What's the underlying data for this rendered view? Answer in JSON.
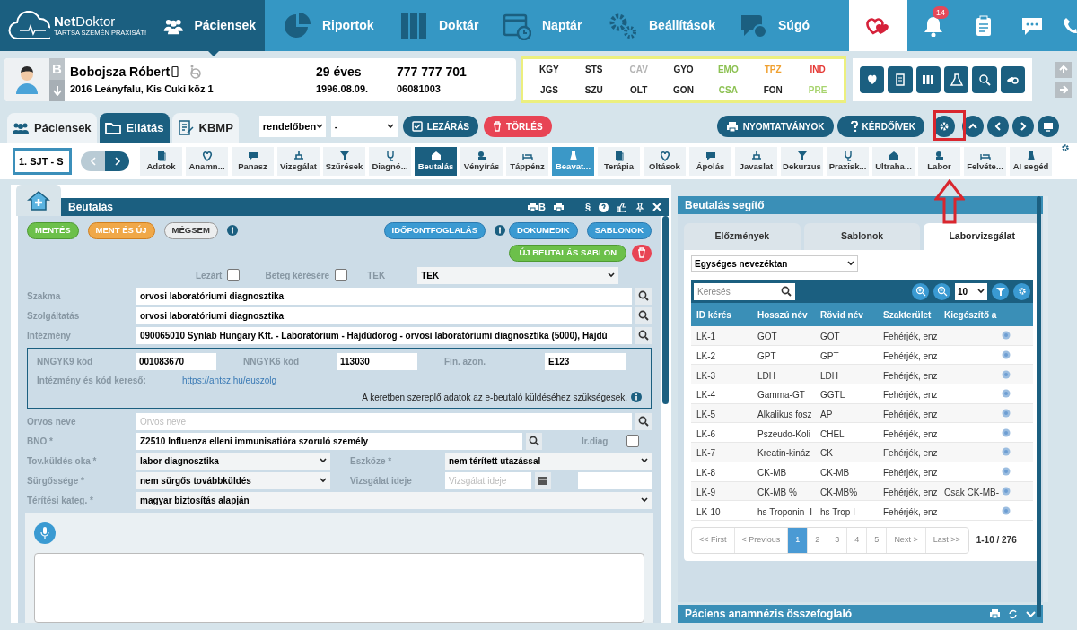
{
  "nav": {
    "logo": {
      "name": "**Net**Doktor",
      "tagline": "TARTSA SZEMÉN PRAXISÁT!"
    },
    "items": [
      {
        "label": "Páciensek",
        "selected": true
      },
      {
        "label": "Riportok",
        "selected": false
      },
      {
        "label": "Doktár",
        "selected": false
      },
      {
        "label": "Naptár",
        "selected": false
      },
      {
        "label": "Beállítások",
        "selected": false
      },
      {
        "label": "Súgó",
        "selected": false
      }
    ],
    "notifications": "14"
  },
  "patient": {
    "initial": "B",
    "name": "Bobojsza Róbert",
    "address": "2016 Leányfalu, Kis Cuki köz 1",
    "age": "29 éves",
    "birth_date": "1996.08.09.",
    "phone": "777 777 701",
    "id_number": "06081003"
  },
  "flags": [
    {
      "code": "KGY",
      "color": "#222222"
    },
    {
      "code": "STS",
      "color": "#222222"
    },
    {
      "code": "CAV",
      "color": "#b4b4b4"
    },
    {
      "code": "GYO",
      "color": "#222222"
    },
    {
      "code": "EMO",
      "color": "#8cc152"
    },
    {
      "code": "TPZ",
      "color": "#f0a030"
    },
    {
      "code": "IND",
      "color": "#e53935"
    },
    {
      "code": "JGS",
      "color": "#222222"
    },
    {
      "code": "SZU",
      "color": "#222222"
    },
    {
      "code": "OLT",
      "color": "#222222"
    },
    {
      "code": "GON",
      "color": "#222222"
    },
    {
      "code": "CSA",
      "color": "#8cc152"
    },
    {
      "code": "FON",
      "color": "#222222"
    },
    {
      "code": "PRE",
      "color": "#a8d46f"
    }
  ],
  "main_tabs": [
    {
      "label": "Páciensek",
      "selected": false
    },
    {
      "label": "Ellátás",
      "selected": true
    },
    {
      "label": "KBMP",
      "selected": false
    }
  ],
  "status_selects": [
    "rendelőben",
    "-"
  ],
  "actions": [
    {
      "label": "LEZÁRÁS",
      "kind": "dark"
    },
    {
      "label": "TÖRLÉS",
      "kind": "danger"
    }
  ],
  "tools": [
    "NYOMTATVÁNYOK",
    "KÉRDŐÍVEK"
  ],
  "episode": "1. SJT - S",
  "modules": [
    {
      "label": "Adatok",
      "selected": false,
      "open": false
    },
    {
      "label": "Anamn...",
      "selected": false,
      "open": false
    },
    {
      "label": "Panasz",
      "selected": false,
      "open": false
    },
    {
      "label": "Vizsgálat",
      "selected": false,
      "open": false
    },
    {
      "label": "Szűrések",
      "selected": false,
      "open": false
    },
    {
      "label": "Diagnó...",
      "selected": false,
      "open": false
    },
    {
      "label": "Beutalás",
      "selected": true,
      "open": false
    },
    {
      "label": "Vényírás",
      "selected": false,
      "open": false
    },
    {
      "label": "Táppénz",
      "selected": false,
      "open": false
    },
    {
      "label": "Beavat...",
      "selected": false,
      "open": true
    },
    {
      "label": "Terápia",
      "selected": false,
      "open": false
    },
    {
      "label": "Oltások",
      "selected": false,
      "open": false
    },
    {
      "label": "Ápolás",
      "selected": false,
      "open": false
    },
    {
      "label": "Javaslat",
      "selected": false,
      "open": false
    },
    {
      "label": "Dekurzus",
      "selected": false,
      "open": false
    },
    {
      "label": "Praxisk...",
      "selected": false,
      "open": false
    },
    {
      "label": "Ultraha...",
      "selected": false,
      "open": false
    },
    {
      "label": "Labor",
      "selected": false,
      "open": false
    },
    {
      "label": "Felvéte...",
      "selected": false,
      "open": false
    },
    {
      "label": "AI segéd",
      "selected": false,
      "open": false
    }
  ],
  "referral": {
    "title": "Beutalás",
    "header_icon_text": [
      "B",
      "§"
    ],
    "buttons": [
      {
        "label": "MENTÉS",
        "kind": "green"
      },
      {
        "label": "MENT ÉS ÚJ",
        "kind": "orange"
      },
      {
        "label": "MÉGSEM",
        "kind": "plain"
      }
    ],
    "right_buttons": [
      "IDŐPONTFOGLALÁS",
      "DOKUMEDIK",
      "SABLONOK"
    ],
    "template_button": "ÚJ BEUTALÁS SABLON",
    "checks": [
      {
        "label": "Lezárt",
        "checked": false
      },
      {
        "label": "Beteg kérésére",
        "checked": false
      }
    ],
    "tek": {
      "label": "TEK",
      "value": "TEK"
    },
    "fields": [
      {
        "label": "Szakma",
        "value": "orvosi laboratóriumi diagnosztika"
      },
      {
        "label": "Szolgáltatás",
        "value": "orvosi laboratóriumi diagnosztika"
      },
      {
        "label": "Intézmény",
        "value": "090065010 Synlab Hungary Kft. - Laboratórium - Hajdúdorog - orvosi laboratóriumi diagnosztika (5000), Hajdú"
      }
    ],
    "codes": [
      {
        "label": "NNGYK9 kód",
        "value": "001083670"
      },
      {
        "label": "NNGYK6 kód",
        "value": "113030"
      },
      {
        "label": "Fin. azon.",
        "value": "E123"
      }
    ],
    "finder": {
      "label": "Intézmény és kód kereső:",
      "link": "https://antsz.hu/euszolg"
    },
    "frame_note": "A keretben szereplő adatok az e-beutaló küldéséhez szükségesek.",
    "doctor": {
      "label": "Orvos neve",
      "placeholder": "Orvos neve"
    },
    "bno": {
      "label": "BNO *",
      "value": "Z2510 Influenza elleni immunisatióra szoruló személy"
    },
    "irdiag": {
      "label": "Ir.diag",
      "checked": false
    },
    "reason": {
      "label": "Tov.küldés oka *",
      "value": "labor diagnosztika"
    },
    "means": {
      "label": "Eszköze *",
      "value": "nem térített utazással"
    },
    "urgency": {
      "label": "Sürgőssége *",
      "value": "nem sürgős továbbküldés"
    },
    "exam_time": {
      "label": "Vizsgálat ideje",
      "placeholder": "Vizsgálat ideje"
    },
    "payment": {
      "label": "Térítési kateg. *",
      "value": "magyar biztosítás alapján"
    }
  },
  "helper": {
    "title": "Beutalás segítő",
    "tabs": [
      {
        "label": "Előzmények",
        "selected": false
      },
      {
        "label": "Sablonok",
        "selected": false
      },
      {
        "label": "Laborvizsgálat",
        "selected": true
      }
    ],
    "nomenclature": "Egységes nevezéktan",
    "search_placeholder": "Keresés",
    "page_size": "10",
    "columns": [
      "ID kérés",
      "Hosszú név",
      "Rövid név",
      "Szakterület",
      "Kiegészítő a"
    ],
    "rows": [
      [
        "LK-1",
        "GOT",
        "GOT",
        "Fehérjék, enz",
        ""
      ],
      [
        "LK-2",
        "GPT",
        "GPT",
        "Fehérjék, enz",
        ""
      ],
      [
        "LK-3",
        "LDH",
        "LDH",
        "Fehérjék, enz",
        ""
      ],
      [
        "LK-4",
        "Gamma-GT",
        "GGTL",
        "Fehérjék, enz",
        ""
      ],
      [
        "LK-5",
        "Alkalikus fosz",
        "AP",
        "Fehérjék, enz",
        ""
      ],
      [
        "LK-6",
        "Pszeudo-Koli",
        "CHEL",
        "Fehérjék, enz",
        ""
      ],
      [
        "LK-7",
        "Kreatin-kináz",
        "CK",
        "Fehérjék, enz",
        ""
      ],
      [
        "LK-8",
        "CK-MB",
        "CK-MB",
        "Fehérjék, enz",
        ""
      ],
      [
        "LK-9",
        "CK-MB %",
        "CK-MB%",
        "Fehérjék, enz",
        "Csak CK-MB-"
      ],
      [
        "LK-10",
        "hs Troponin- I",
        "hs Trop I",
        "Fehérjék, enz",
        ""
      ]
    ],
    "pages": [
      {
        "label": "<< First",
        "selected": false
      },
      {
        "label": "< Previous",
        "selected": false
      },
      {
        "label": "1",
        "selected": true
      },
      {
        "label": "2",
        "selected": false
      },
      {
        "label": "3",
        "selected": false
      },
      {
        "label": "4",
        "selected": false
      },
      {
        "label": "5",
        "selected": false
      },
      {
        "label": "Next >",
        "selected": false
      },
      {
        "label": "Last >>",
        "selected": false
      }
    ],
    "summary": "1-10 / 276"
  },
  "summary_panel": {
    "title": "Páciens anamnézis összefoglaló"
  }
}
